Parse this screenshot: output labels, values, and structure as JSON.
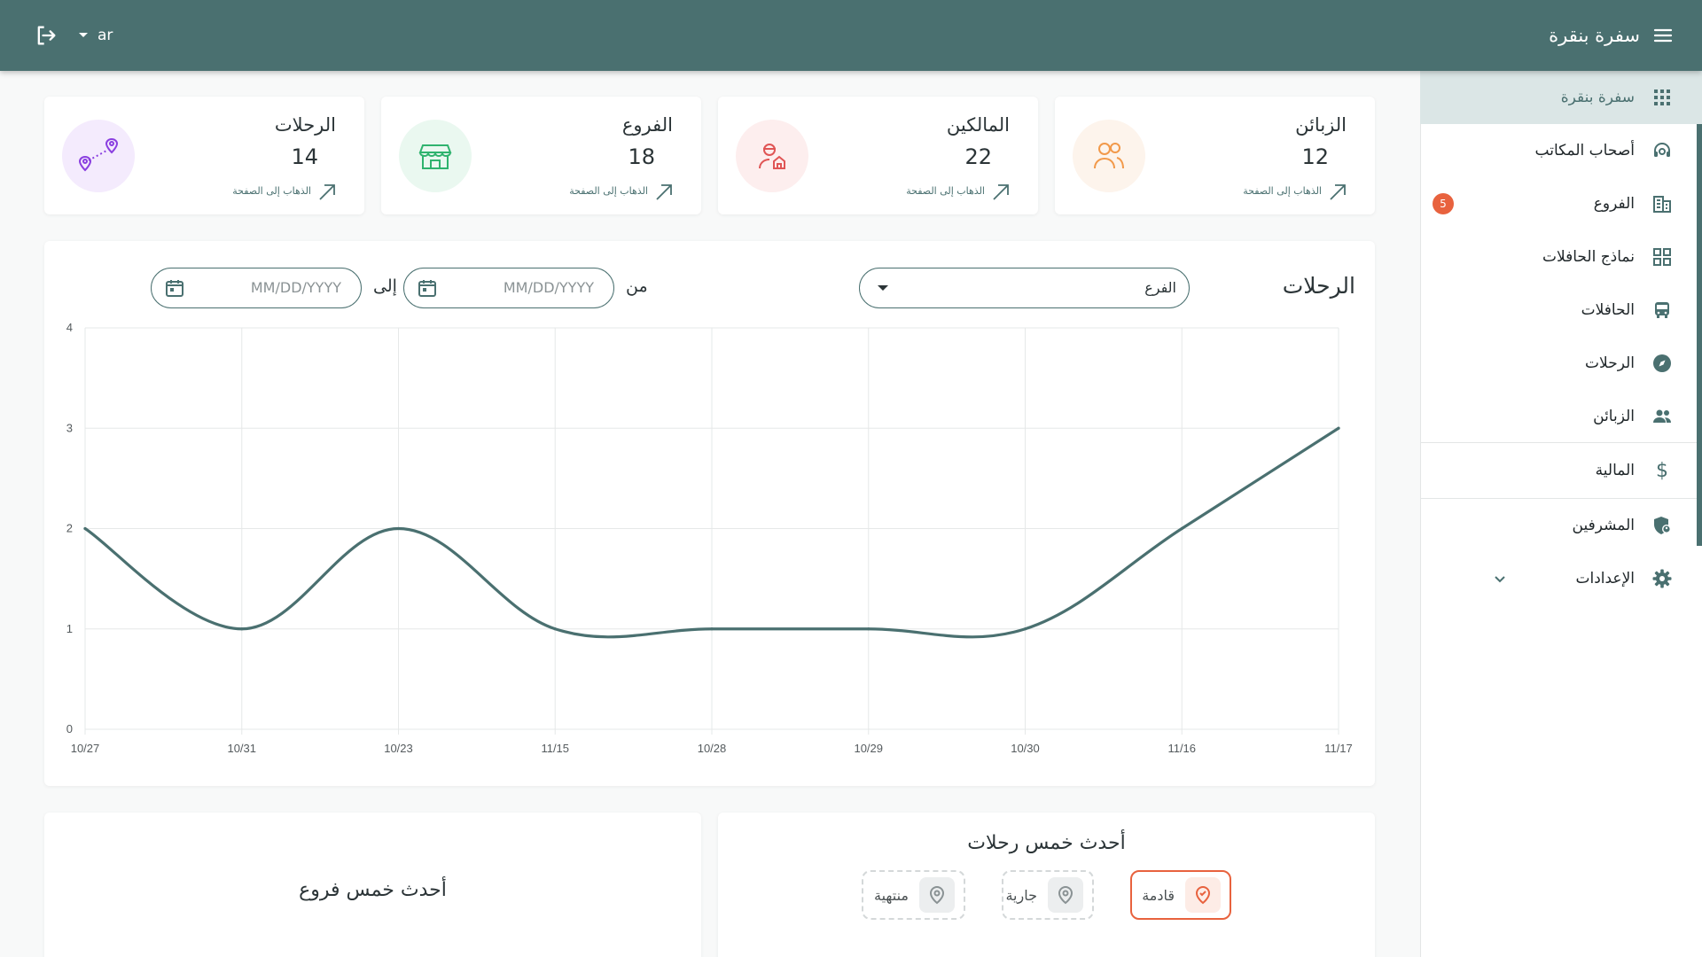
{
  "header": {
    "app_title": "سفرة بنقرة",
    "language": "ar"
  },
  "sidebar": {
    "items": [
      {
        "label": "سفرة بنقرة",
        "icon": "grid-dots-icon",
        "active": true
      },
      {
        "label": "أصحاب المكاتب",
        "icon": "headset-icon"
      },
      {
        "label": "الفروع",
        "icon": "building-icon",
        "badge": "5"
      },
      {
        "label": "نماذج الحافلات",
        "icon": "grid-squares-icon"
      },
      {
        "label": "الحافلات",
        "icon": "bus-icon"
      },
      {
        "label": "الرحلات",
        "icon": "compass-icon"
      },
      {
        "label": "الزبائن",
        "icon": "people-icon"
      },
      {
        "label": "المالية",
        "icon": "dollar-icon"
      },
      {
        "label": "المشرفين",
        "icon": "shield-person-icon"
      },
      {
        "label": "الإعدادات",
        "icon": "gear-icon"
      }
    ]
  },
  "stats": [
    {
      "title": "الزبائن",
      "value": "12",
      "link": "الذهاب إلى الصفحة",
      "icon": "users-icon",
      "color": "#f2994a",
      "bg": "#fdf4ec"
    },
    {
      "title": "المالكين",
      "value": "22",
      "link": "الذهاب إلى الصفحة",
      "icon": "owner-icon",
      "color": "#e05555",
      "bg": "#fdeeee"
    },
    {
      "title": "الفروع",
      "value": "18",
      "link": "الذهاب إلى الصفحة",
      "icon": "store-icon",
      "color": "#2fb36e",
      "bg": "#eaf8f0"
    },
    {
      "title": "الرحلات",
      "value": "14",
      "link": "الذهاب إلى الصفحة",
      "icon": "route-icon",
      "color": "#8a3fe0",
      "bg": "#f4ebfd"
    }
  ],
  "trips_panel": {
    "title": "الرحلات",
    "branch_select": "الفرع",
    "from_label": "من",
    "to_label": "إلى",
    "date_placeholder": "MM/DD/YYYY"
  },
  "chart_data": {
    "type": "line",
    "categories": [
      "10/27",
      "10/31",
      "10/23",
      "11/15",
      "10/28",
      "10/29",
      "10/30",
      "11/16",
      "11/17"
    ],
    "values": [
      2,
      1,
      2,
      1,
      1,
      1,
      1,
      2,
      3
    ],
    "ylim": [
      0,
      4
    ],
    "yticks": [
      0,
      1,
      2,
      3,
      4
    ],
    "grid": true,
    "line_color": "#4a7070"
  },
  "latest_trips": {
    "title": "أحدث خمس رحلات",
    "filters": [
      {
        "label": "قادمة",
        "selected": true
      },
      {
        "label": "جارية",
        "selected": false
      },
      {
        "label": "منتهية",
        "selected": false
      }
    ]
  },
  "latest_branches": {
    "title": "أحدث خمس فروع"
  }
}
